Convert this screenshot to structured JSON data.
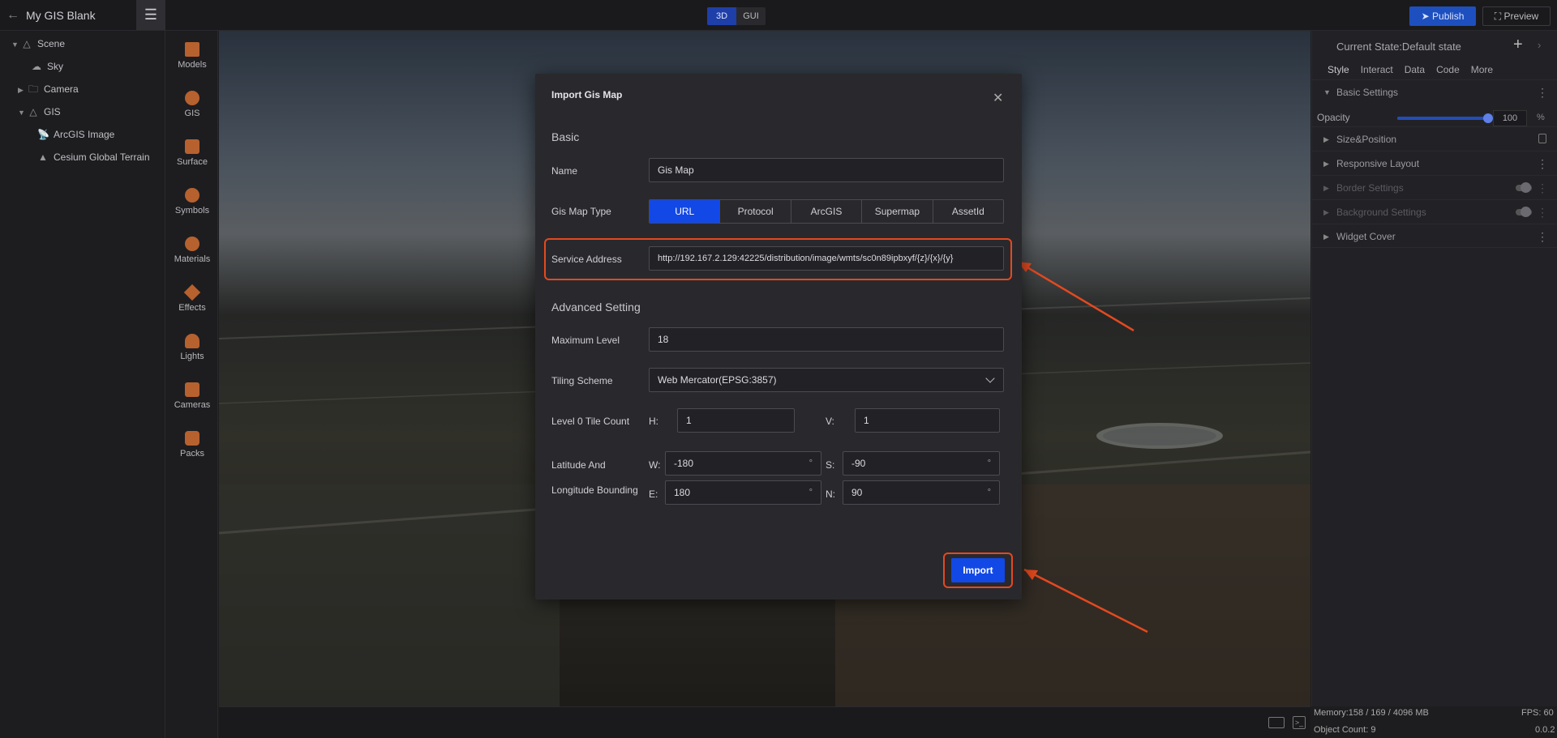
{
  "topbar": {
    "title": "My GIS Blank",
    "modes": [
      "3D",
      "GUI"
    ],
    "active_mode": "3D",
    "publish": "Publish",
    "preview": "Preview"
  },
  "tree": {
    "items": [
      {
        "label": "Scene",
        "icon": "scene-icon"
      },
      {
        "label": "Sky",
        "icon": "sky-icon"
      },
      {
        "label": "Camera",
        "icon": "folder-icon"
      },
      {
        "label": "GIS",
        "icon": "gis-icon"
      },
      {
        "label": "ArcGIS Image",
        "icon": "satellite-icon"
      },
      {
        "label": "Cesium Global Terrain",
        "icon": "terrain-icon"
      }
    ]
  },
  "assets": {
    "items": [
      "Models",
      "GIS",
      "Surface",
      "Symbols",
      "Materials",
      "Effects",
      "Lights",
      "Cameras",
      "Packs"
    ]
  },
  "right_panel": {
    "state": "Current State:Default state",
    "tabs": [
      "Style",
      "Interact",
      "Data",
      "Code",
      "More"
    ],
    "basic_settings": "Basic Settings",
    "opacity_label": "Opacity",
    "opacity_value": "100",
    "opacity_unit": "%",
    "opacity_level": 1.0,
    "sections": [
      "Size&Position",
      "Responsive Layout",
      "Border Settings",
      "Background Settings",
      "Widget Cover"
    ]
  },
  "status": {
    "memory": "Memory:158 / 169 / 4096 MB",
    "fps": "FPS: 60",
    "object_count": "Object Count: 9",
    "version": "0.0.2"
  },
  "dialog": {
    "title": "Import Gis Map",
    "basic_heading": "Basic",
    "name_label": "Name",
    "name_value": "Gis Map",
    "type_label": "Gis Map Type",
    "types": [
      "URL",
      "Protocol",
      "ArcGIS",
      "Supermap",
      "AssetId"
    ],
    "active_type": "URL",
    "service_label": "Service Address",
    "service_value": "http://192.167.2.129:42225/distribution/image/wmts/sc0n89ipbxyf/{z}/{x}/{y}",
    "advanced_heading": "Advanced Setting",
    "max_level_label": "Maximum Level",
    "max_level_value": "18",
    "tiling_label": "Tiling Scheme",
    "tiling_value": "Web Mercator(EPSG:3857)",
    "tile_count_label": "Level 0 Tile Count",
    "h_label": "H:",
    "h_value": "1",
    "v_label": "V:",
    "v_value": "1",
    "bounding_label_1": "Latitude And",
    "bounding_label_2": "Longitude Bounding",
    "w_label": "W:",
    "w_value": "-180",
    "s_label": "S:",
    "s_value": "-90",
    "e_label": "E:",
    "e_value": "180",
    "n_label": "N:",
    "n_value": "90",
    "degree": "°",
    "import": "Import"
  },
  "colors": {
    "accent": "#1248e6",
    "highlight": "#e4491f"
  }
}
